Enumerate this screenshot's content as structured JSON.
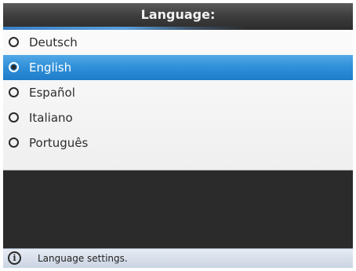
{
  "dialog": {
    "title": "Language:"
  },
  "languages": [
    {
      "label": "Deutsch",
      "selected": false
    },
    {
      "label": "English",
      "selected": true
    },
    {
      "label": "Español",
      "selected": false
    },
    {
      "label": "Italiano",
      "selected": false
    },
    {
      "label": "Português",
      "selected": false
    }
  ],
  "status": {
    "icon": "info-icon",
    "text": "Language settings."
  },
  "colors": {
    "selection": "#2f8fd8",
    "background": "#2b2b2b",
    "panel": "#f4f4f4"
  }
}
